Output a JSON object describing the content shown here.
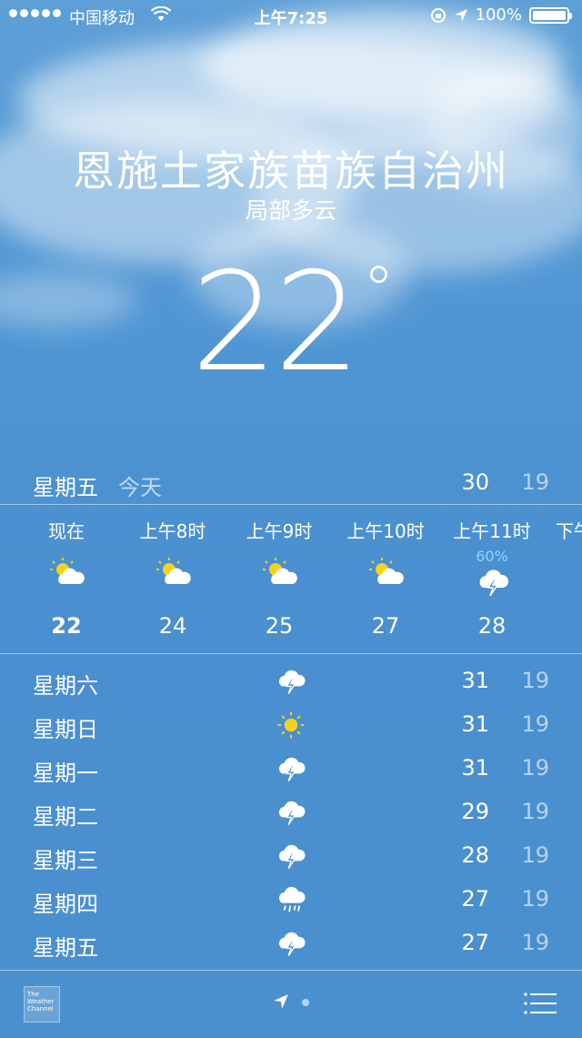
{
  "status": {
    "carrier": "中国移动",
    "time": "上午7:25",
    "battery": "100%",
    "icons": [
      "signal-dots-icon",
      "wifi-icon",
      "rotation-lock-icon",
      "location-arrow-icon",
      "battery-icon"
    ]
  },
  "location": {
    "city": "恩施土家族苗族自治州",
    "condition": "局部多云",
    "temp": "22",
    "deg": "°"
  },
  "today": {
    "day": "星期五",
    "label": "今天",
    "high": "30",
    "low": "19"
  },
  "hourly": [
    {
      "time": "现在",
      "icon": "partly-cloudy-icon",
      "temp": "22",
      "pop": ""
    },
    {
      "time": "上午8时",
      "icon": "partly-cloudy-icon",
      "temp": "24",
      "pop": ""
    },
    {
      "time": "上午9时",
      "icon": "partly-cloudy-icon",
      "temp": "25",
      "pop": ""
    },
    {
      "time": "上午10时",
      "icon": "partly-cloudy-icon",
      "temp": "27",
      "pop": ""
    },
    {
      "time": "上午11时",
      "icon": "thunderstorm-icon",
      "temp": "28",
      "pop": "60%"
    },
    {
      "time": "下午",
      "icon": "",
      "temp": "",
      "pop": ""
    }
  ],
  "daily": [
    {
      "day": "星期六",
      "icon": "thunderstorm-icon",
      "high": "31",
      "low": "19"
    },
    {
      "day": "星期日",
      "icon": "sun-icon",
      "high": "31",
      "low": "19"
    },
    {
      "day": "星期一",
      "icon": "thunderstorm-icon",
      "high": "31",
      "low": "19"
    },
    {
      "day": "星期二",
      "icon": "thunderstorm-icon",
      "high": "29",
      "low": "19"
    },
    {
      "day": "星期三",
      "icon": "thunderstorm-icon",
      "high": "28",
      "low": "19"
    },
    {
      "day": "星期四",
      "icon": "rain-icon",
      "high": "27",
      "low": "19"
    },
    {
      "day": "星期五",
      "icon": "thunderstorm-icon",
      "high": "27",
      "low": "19"
    }
  ],
  "footer": {
    "twc_label": "The Weather Channel",
    "icons": [
      "weather-channel-logo",
      "location-arrow-icon",
      "page-dot-icon",
      "list-icon"
    ]
  }
}
